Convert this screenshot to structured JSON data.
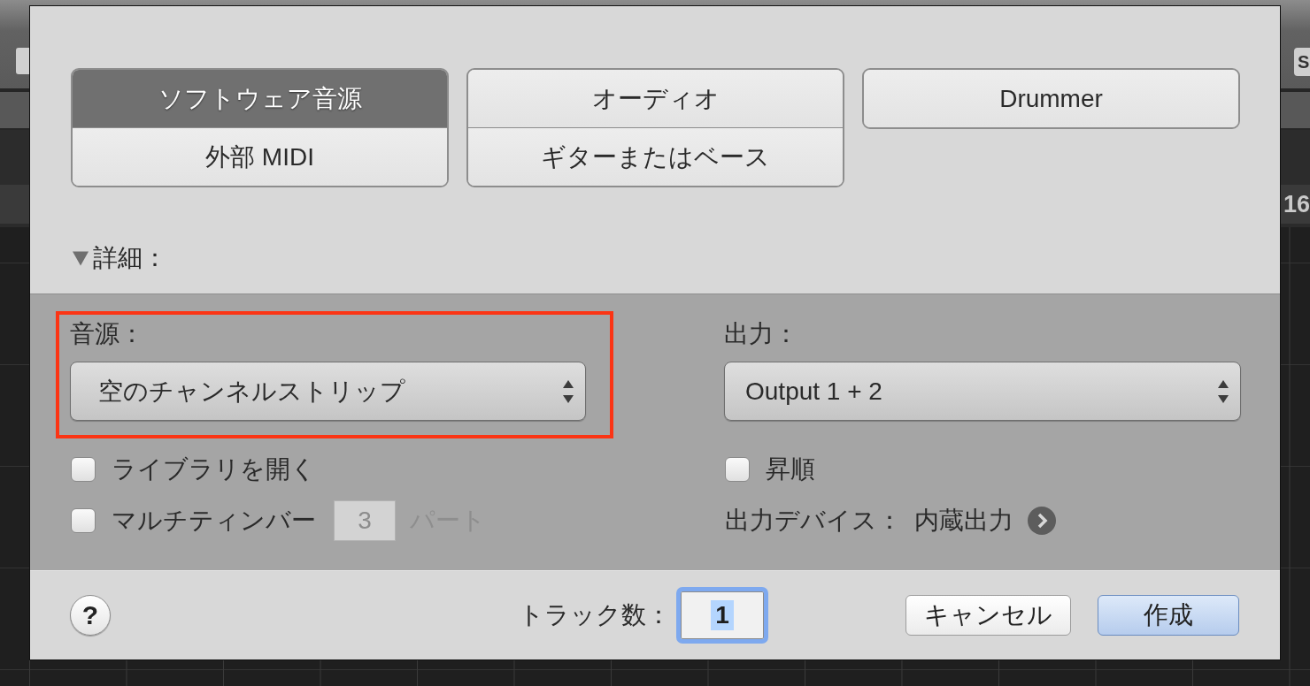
{
  "background": {
    "toolbar_button": "S",
    "ruler_number": "16"
  },
  "track_types": [
    {
      "options": [
        {
          "label": "ソフトウェア音源",
          "selected": true
        },
        {
          "label": "外部 MIDI",
          "selected": false
        }
      ]
    },
    {
      "options": [
        {
          "label": "オーディオ",
          "selected": false
        },
        {
          "label": "ギターまたはベース",
          "selected": false
        }
      ]
    },
    {
      "options": [
        {
          "label": "Drummer",
          "selected": false
        }
      ]
    }
  ],
  "details": {
    "label": "詳細：",
    "expanded": true
  },
  "instrument": {
    "label": "音源：",
    "value": "空のチャンネルストリップ",
    "highlighted": true
  },
  "instrument_options": [
    {
      "kind": "checkbox",
      "label": "ライブラリを開く",
      "checked": false
    },
    {
      "kind": "checkbox_count",
      "label": "マルチティンバー",
      "checked": false,
      "count": "3",
      "unit": "パート",
      "disabled": true
    }
  ],
  "output": {
    "label": "出力：",
    "value": "Output 1 + 2"
  },
  "ascending": {
    "label": "昇順",
    "checked": false
  },
  "output_device": {
    "label": "出力デバイス：",
    "value": "内蔵出力"
  },
  "footer": {
    "help": "?",
    "track_count": {
      "label": "トラック数：",
      "value": "1",
      "focused": true
    },
    "buttons": [
      {
        "label": "キャンセル",
        "default": false
      },
      {
        "label": "作成",
        "default": true
      }
    ]
  }
}
